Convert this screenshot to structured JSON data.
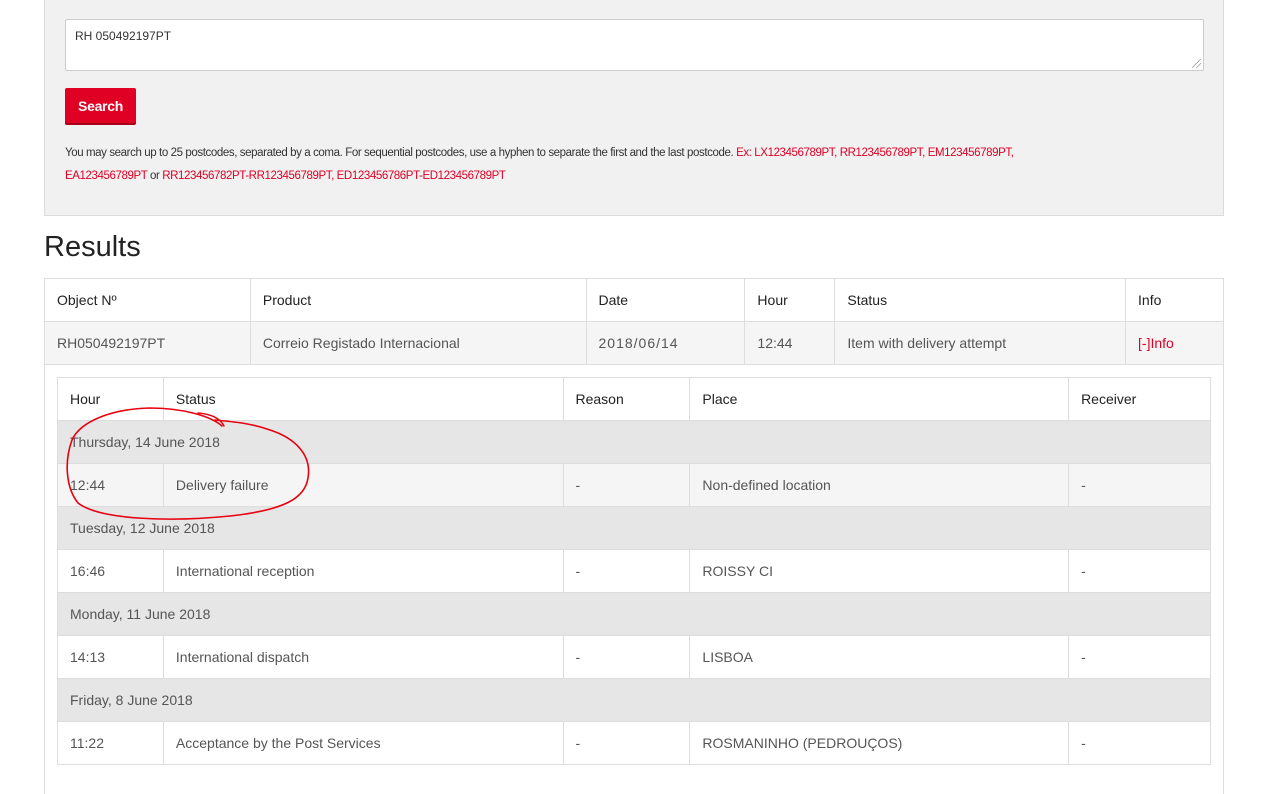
{
  "search": {
    "value": "RH 050492197PT",
    "button_label": "Search",
    "help_text": "You may search up to 25 postcodes, separated by a coma. For sequential postcodes, use a hyphen to separate the first and the last postcode.",
    "example_prefix": "Ex: LX123456789PT, RR123456789PT, EM123456789PT,",
    "example_line2_a": "EA123456789PT",
    "example_or": " or ",
    "example_line2_b": "RR123456782PT-RR123456789PT, ED123456786PT-ED123456789PT"
  },
  "results": {
    "title": "Results",
    "columns": [
      "Object Nº",
      "Product",
      "Date",
      "Hour",
      "Status",
      "Info"
    ],
    "row": {
      "object": "RH050492197PT",
      "product": "Correio Registado Internacional",
      "date": "2018/06/14",
      "hour": "12:44",
      "status": "Item with delivery attempt",
      "info_link": "[-]Info"
    }
  },
  "events": {
    "columns": [
      "Hour",
      "Status",
      "Reason",
      "Place",
      "Receiver"
    ],
    "days": [
      {
        "label": "Thursday, 14 June 2018",
        "events": [
          {
            "hour": "12:44",
            "status": "Delivery failure",
            "reason": "-",
            "place": "Non-defined location",
            "receiver": "-"
          }
        ]
      },
      {
        "label": "Tuesday, 12 June 2018",
        "events": [
          {
            "hour": "16:46",
            "status": "International reception",
            "reason": "-",
            "place": "ROISSY CI",
            "receiver": "-"
          }
        ]
      },
      {
        "label": "Monday, 11 June 2018",
        "events": [
          {
            "hour": "14:13",
            "status": "International dispatch",
            "reason": "-",
            "place": "LISBOA",
            "receiver": "-"
          }
        ]
      },
      {
        "label": "Friday, 8 June 2018",
        "events": [
          {
            "hour": "11:22",
            "status": "Acceptance by the Post Services",
            "reason": "-",
            "place": "ROSMANINHO (PEDROUÇOS)",
            "receiver": "-"
          }
        ]
      }
    ]
  },
  "colors": {
    "accent": "#df0024",
    "annotation": "#e8000f"
  }
}
